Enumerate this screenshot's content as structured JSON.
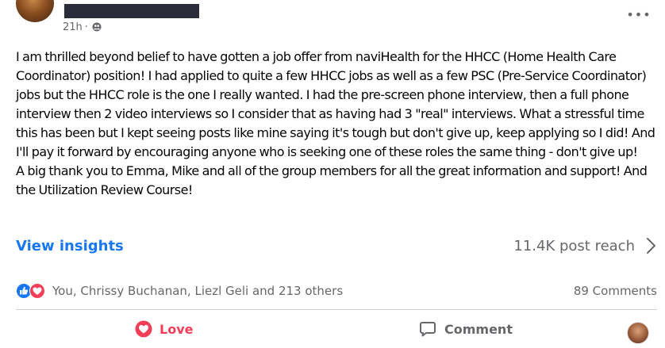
{
  "post": {
    "timestamp": "21h",
    "separator": "·",
    "audience_icon": "friends-icon",
    "more_label": "•••",
    "body": [
      "I am thrilled beyond belief to have gotten a job offer from naviHealth for the HHCC (Home Health Care Coordinator) position! I had applied to quite a few HHCC jobs as well as a few PSC (Pre-Service Coordinator) jobs but the HHCC role is the one I really wanted. I had the pre-screen phone interview, then a full phone interview then 2 video interviews so I consider that as having had 3 \"real\" interviews. What a stressful time this has been but I kept seeing posts like mine saying it's tough but don't give up, keep applying so I did! And I'll pay it forward by encouraging anyone who is seeking one of these roles the same thing - don't give up!",
      "A big thank you to Emma, Mike and all of the group members for all the great information and support! And the Utilization Review Course!"
    ]
  },
  "insights": {
    "link_label": "View insights",
    "reach_label": "11.4K post reach"
  },
  "reactions": {
    "icons": [
      "like-icon",
      "heart-icon"
    ],
    "summary": "You, Chrissy Buchanan, Liezl Geli and 213 others",
    "comments": "89 Comments"
  },
  "actions": {
    "love_label": "Love",
    "comment_label": "Comment"
  },
  "colors": {
    "accent_blue": "#1877f2",
    "love_red": "#f33e58",
    "secondary_text": "#65676b"
  }
}
